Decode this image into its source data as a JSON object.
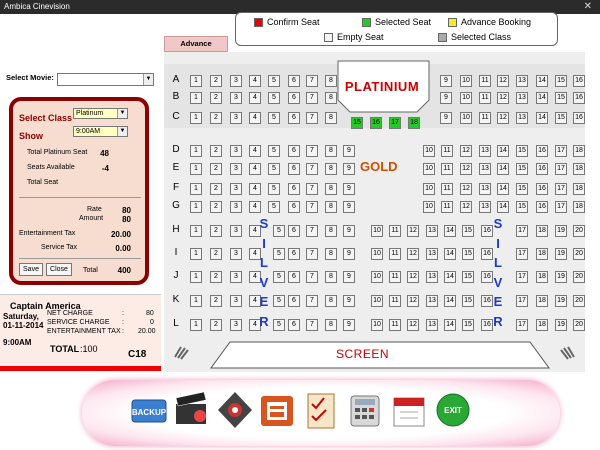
{
  "window": {
    "title": "Ambica Cinevision",
    "close_glyph": "✕"
  },
  "legend": {
    "confirm": {
      "label": "Confirm Seat",
      "color": "#ee0000"
    },
    "selected": {
      "label": "Selected Seat",
      "color": "#22cc22"
    },
    "advance": {
      "label": "Advance Booking",
      "color": "#f2ec2a"
    },
    "empty": {
      "label": "Empty Seat",
      "color": "#f4f4f4"
    },
    "selclass": {
      "label": "Selected Class",
      "color": "#aaaaaa"
    }
  },
  "advance_tab": "Advance Booking",
  "sections": {
    "platinium": "PLATINIUM",
    "gold": "GOLD",
    "silver": "SILVER",
    "screen": "SCREEN"
  },
  "rows": [
    {
      "label": "A",
      "seats": [
        1,
        2,
        3,
        4,
        5,
        6,
        7,
        8,
        9,
        10,
        11,
        12,
        13,
        14,
        15,
        16
      ]
    },
    {
      "label": "B",
      "seats": [
        1,
        2,
        3,
        4,
        5,
        6,
        7,
        8,
        9,
        10,
        11,
        12,
        13,
        14,
        15,
        16
      ]
    },
    {
      "label": "C",
      "seats": [
        1,
        2,
        3,
        4,
        5,
        6,
        7,
        8,
        9,
        10,
        11,
        12,
        13,
        14,
        15,
        16
      ]
    },
    {
      "label": "D",
      "seats": [
        1,
        2,
        3,
        4,
        5,
        6,
        7,
        8,
        9,
        10,
        11,
        12,
        13,
        14,
        15,
        16,
        17,
        18
      ]
    },
    {
      "label": "E",
      "seats": [
        1,
        2,
        3,
        4,
        5,
        6,
        7,
        8,
        9,
        10,
        11,
        12,
        13,
        14,
        15,
        16,
        17,
        18
      ]
    },
    {
      "label": "F",
      "seats": [
        1,
        2,
        3,
        4,
        5,
        6,
        7,
        8,
        9,
        10,
        11,
        12,
        13,
        14,
        15,
        16,
        17,
        18
      ]
    },
    {
      "label": "G",
      "seats": [
        1,
        2,
        3,
        4,
        5,
        6,
        7,
        8,
        9,
        10,
        11,
        12,
        13,
        14,
        15,
        16,
        17,
        18
      ]
    },
    {
      "label": "H",
      "seats": [
        1,
        2,
        3,
        4,
        5,
        6,
        7,
        8,
        9,
        10,
        11,
        12,
        13,
        14,
        15,
        16,
        17,
        18,
        19,
        20
      ]
    },
    {
      "label": "I",
      "seats": [
        1,
        2,
        3,
        4,
        5,
        6,
        7,
        8,
        9,
        10,
        11,
        12,
        13,
        14,
        15,
        16,
        17,
        18,
        19,
        20
      ]
    },
    {
      "label": "J",
      "seats": [
        1,
        2,
        3,
        4,
        5,
        6,
        7,
        8,
        9,
        10,
        11,
        12,
        13,
        14,
        15,
        16,
        17,
        18,
        19,
        20
      ]
    },
    {
      "label": "K",
      "seats": [
        1,
        2,
        3,
        4,
        5,
        6,
        7,
        8,
        9,
        10,
        11,
        12,
        13,
        14,
        15,
        16,
        17,
        18,
        19,
        20
      ]
    },
    {
      "label": "L",
      "seats": [
        1,
        2,
        3,
        4,
        5,
        6,
        7,
        8,
        9,
        10,
        11,
        12,
        13,
        14,
        15,
        16,
        17,
        18,
        19,
        20
      ]
    }
  ],
  "selected_seats": [
    "15",
    "16",
    "17",
    "18"
  ],
  "left": {
    "select_movie_label": "Select Movie:",
    "select_movie_value": "",
    "select_class_label": "Select Class",
    "select_class_value": "Platinum",
    "show_label": "Show",
    "show_value": "9:00AM",
    "total_seat_label": "Total Platinum Seat",
    "total_seat_value": "48",
    "seats_available_label": "Seats Available",
    "seats_available_value": "-4",
    "total_label": "Total Seat",
    "rate_label": "Rate",
    "rate_value": "80",
    "amount_label": "Amount",
    "amount_value": "80",
    "ent_tax_label": "Entertainment Tax",
    "ent_tax_value": "20.00",
    "service_tax_label": "Service Tax",
    "service_tax_value": "0.00",
    "save_label": "Save",
    "close_label": "Close",
    "total_amt_label": "Total",
    "total_amt_value": "400"
  },
  "ticket": {
    "movie": "Captain America",
    "day": "Saturday,",
    "date": "01-11-2014",
    "time": "9:00AM",
    "net_charge_label": "NET CHARGE",
    "net_charge_value": "80",
    "service_charge_label": "SERVICE CHARGE",
    "service_charge_value": "0",
    "ent_tax_label": "ENTERTAINMENT TAX",
    "ent_tax_value": "20.00",
    "colon": ":",
    "total_label": "TOTAL",
    "total_value": ":100",
    "seat": "C18"
  },
  "dock": {
    "backup_label": "BACKUP",
    "exit_label": "EXIT",
    "icons": [
      "backup-icon",
      "movie-clapper-icon",
      "projector-icon",
      "phone-icon",
      "checklist-icon",
      "calculator-icon",
      "calendar-icon",
      "exit-icon"
    ]
  }
}
